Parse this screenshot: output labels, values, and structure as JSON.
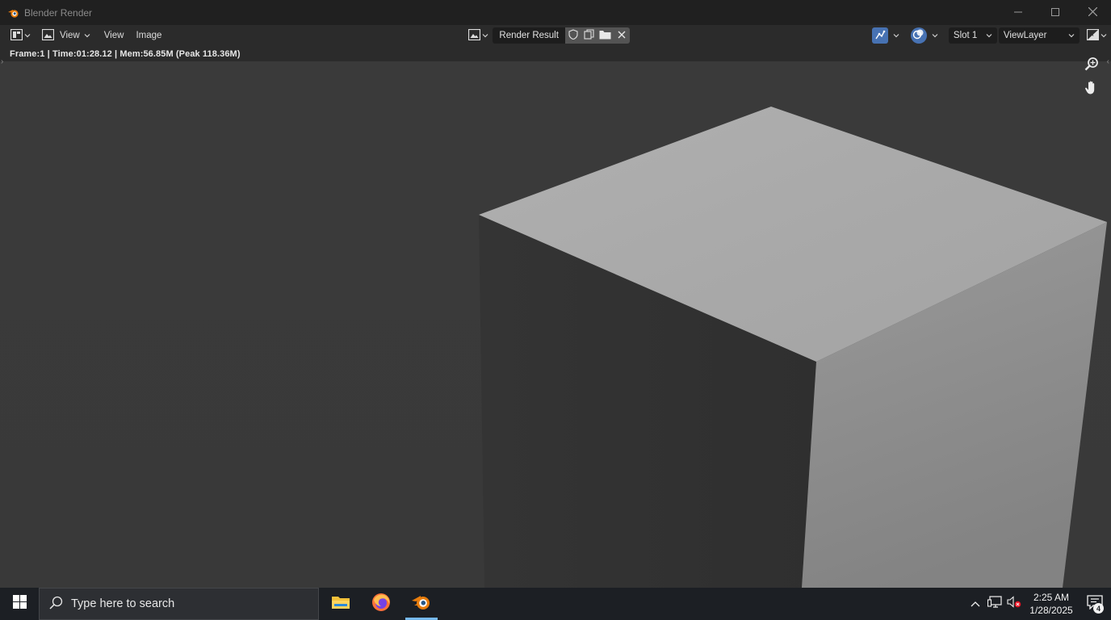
{
  "window": {
    "title": "Blender Render",
    "app_icon": "blender-icon",
    "controls": [
      "minimize-icon",
      "maximize-icon",
      "close-icon"
    ]
  },
  "header": {
    "editor_type_icon": "image-editor-icon",
    "view_mode_icon": "view-image-icon",
    "view_mode_label": "View",
    "menus": {
      "view": "View",
      "image": "Image"
    },
    "image_browse_icon": "image-browse-icon",
    "image_name": "Render Result",
    "image_actions": [
      "fake-user-shield-icon",
      "duplicate-image-icon",
      "open-image-folder-icon",
      "unlink-close-icon"
    ],
    "sample_tool_icon": "sample-tool-icon",
    "overlay_icon": "overlay-icon",
    "slot": "Slot 1",
    "view_layer": "ViewLayer",
    "display_channels_icon": "display-channels-icon"
  },
  "viewport": {
    "stats": "Frame:1 | Time:01:28.12 | Mem:56.85M (Peak 118.36M)",
    "nav_tools": [
      "zoom-icon",
      "pan-hand-icon"
    ],
    "colors": {
      "background": "#393939",
      "cube_top": "#a8a8a8",
      "cube_left": "#313131",
      "cube_right": "#8f8f8f"
    }
  },
  "taskbar": {
    "start_icon": "windows-start-icon",
    "search_placeholder": "Type here to search",
    "apps": [
      {
        "name": "file-explorer-icon",
        "active": false
      },
      {
        "name": "firefox-icon",
        "active": false
      },
      {
        "name": "blender-icon",
        "active": true
      }
    ],
    "tray_icons": [
      "chevron-up-icon",
      "network-icon",
      "volume-muted-icon"
    ],
    "time": "2:25 AM",
    "date": "1/28/2025",
    "notification_count": "4"
  }
}
